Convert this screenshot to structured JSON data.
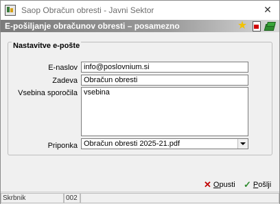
{
  "window": {
    "title": "Saop Obračun obresti - Javni Sektor",
    "close": "✕"
  },
  "header": {
    "title": "E-pošiljanje obračunov obresti – posamezno"
  },
  "group": {
    "legend": "Nastavitve e-pošte"
  },
  "form": {
    "email_label": "E-naslov",
    "email_value": "info@poslovnium.si",
    "subject_label": "Zadeva",
    "subject_value": "Obračun obresti",
    "body_label": "Vsebina sporočila",
    "body_value": "vsebina",
    "attachment_label": "Priponka",
    "attachment_value": "Obračun obresti 2025-21.pdf"
  },
  "buttons": {
    "cancel_label": "Opusti",
    "cancel_mnemonic": "O",
    "cancel_rest": "pusti",
    "send_label": "Pošlji",
    "send_mnemonic": "P",
    "send_rest": "ošlji",
    "cancel_color": "#c00000",
    "send_color": "#2e8b2e"
  },
  "status": {
    "user": "Skrbnik",
    "code": "002"
  },
  "icons": [
    "app-icon",
    "close-icon",
    "star-icon",
    "pdf-icon",
    "book-icon",
    "x-icon",
    "check-icon",
    "dropdown-arrow-icon"
  ]
}
